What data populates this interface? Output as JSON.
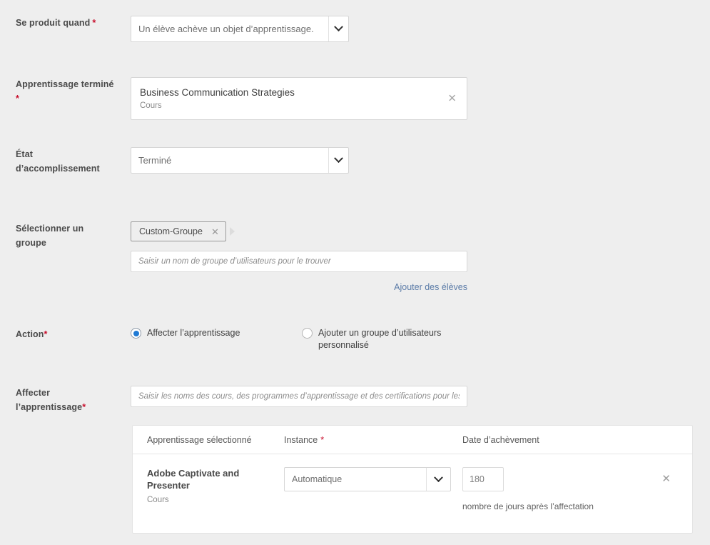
{
  "colors": {
    "page_background": "#eeeeee",
    "label_text": "#4a4a4a",
    "required_asterisk": "#c8102e",
    "link": "#5c7ca8",
    "radio_selected": "#1f7ad4",
    "field_border": "#d6d6d6",
    "placeholder_text": "#8d8d8d"
  },
  "fields": {
    "trigger": {
      "label": "Se produit quand",
      "required": true,
      "control": "select",
      "value": "Un élève achève un objet d’apprentissage.",
      "arrow_icon": "chevron-down-icon"
    },
    "completed_learning": {
      "label": "Apprentissage terminé",
      "required": true,
      "control": "selected-object",
      "title": "Business Communication Strategies",
      "subtitle": "Cours",
      "clear_icon": "close-icon"
    },
    "completion_state": {
      "label": "État d’accomplissement",
      "required": false,
      "control": "select",
      "value": "Terminé",
      "arrow_icon": "chevron-down-icon"
    },
    "select_group": {
      "label": "Sélectionner un groupe",
      "required": false,
      "chips": [
        {
          "text": "Custom-Groupe",
          "remove_icon": "close-icon"
        }
      ],
      "overflow_icon": "caret-right-icon",
      "search_placeholder": "Saisir un nom de groupe d’utilisateurs pour le trouver",
      "search_value": "",
      "add_learners_link": "Ajouter des élèves"
    },
    "action": {
      "label": "Action",
      "required": true,
      "options": [
        {
          "label": "Affecter l’apprentissage",
          "selected": true
        },
        {
          "label": "Ajouter un groupe d’utilisateurs personnalisé",
          "selected": false
        }
      ]
    },
    "assign_learning": {
      "label": "Affecter l’apprentissage",
      "required": true,
      "search_placeholder": "Saisir les noms des cours, des programmes d’apprentissage et des certifications pour les trouver",
      "search_value": ""
    }
  },
  "table": {
    "headers": {
      "selected_learning": "Apprentissage sélectionné",
      "instance": "Instance",
      "instance_required": "*",
      "completion_date": "Date d’achèvement"
    },
    "rows": [
      {
        "title": "Adobe Captivate and Presenter",
        "subtitle": "Cours",
        "instance_value": "Automatique",
        "instance_arrow_icon": "chevron-down-icon",
        "days_value": "180",
        "days_note": "nombre de jours après l’affectation",
        "delete_icon": "close-icon"
      }
    ]
  }
}
